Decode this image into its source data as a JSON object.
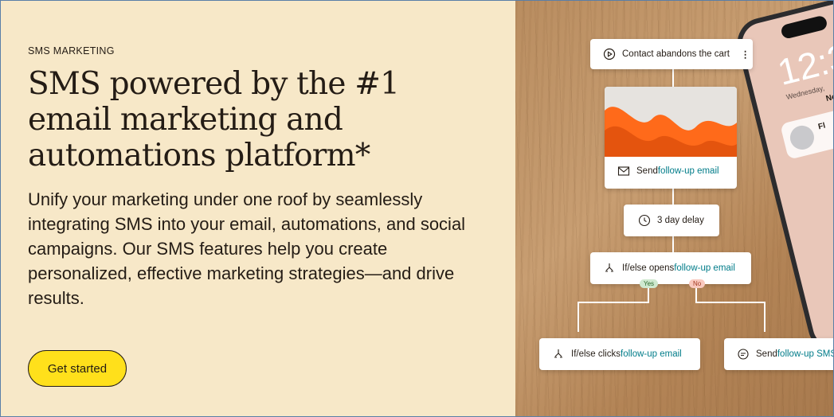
{
  "hero": {
    "eyebrow": "SMS MARKETING",
    "headline": "SMS powered by the #1 email marketing and automations platform*",
    "body": "Unify your marketing under one roof by seamlessly integrating SMS into your email, automations, and social campaigns. Our SMS features help you create personalized, effective marketing strategies—and drive results.",
    "cta_label": "Get started"
  },
  "colors": {
    "background": "#f7e8c8",
    "cta": "#ffe01b",
    "text": "#241c15",
    "link": "#007c89"
  },
  "flow": {
    "trigger": {
      "label": "Contact abandons the cart",
      "icon": "play-circle-icon"
    },
    "email_step": {
      "prefix": "Send ",
      "link": "follow-up email",
      "icon": "envelope-icon"
    },
    "delay": {
      "label": "3 day delay",
      "icon": "clock-icon"
    },
    "branch": {
      "prefix": "If/else opens ",
      "link": "follow-up email",
      "icon": "branch-icon"
    },
    "yes_label": "Yes",
    "no_label": "No",
    "left_branch": {
      "prefix": "If/else clicks ",
      "link": "follow-up email",
      "icon": "branch-icon"
    },
    "right_branch": {
      "prefix": "Send ",
      "link": "follow-up SMS",
      "icon": "chat-icon"
    }
  },
  "phone": {
    "time": "12:3",
    "day": "Wednesday,",
    "new_label": "New",
    "notification_title": "Fl"
  }
}
